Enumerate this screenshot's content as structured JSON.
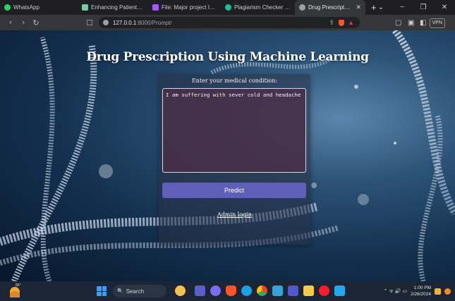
{
  "browser": {
    "tabs": [
      {
        "label": "WhatsApp",
        "icon": "whatsapp-icon",
        "color": "#25d366"
      },
      {
        "label": "Enhancing Patient Satisfactio",
        "icon": "doc-icon",
        "color": "#7bc8a4"
      },
      {
        "label": "File: Major project IEEE - Cop",
        "icon": "figma-icon",
        "color": "#a259ff"
      },
      {
        "label": "Plagiarism Checker | Grammar",
        "icon": "grammarly-icon",
        "color": "#15c39a"
      },
      {
        "label": "Drug Prescription Using",
        "icon": "globe-icon",
        "color": "#9aa0a6",
        "active": true
      }
    ],
    "new_tab": "+",
    "window_controls": {
      "list": "⌄",
      "minimize": "−",
      "maximize": "❐",
      "close": "✕"
    },
    "nav": {
      "back": "‹",
      "forward": "›",
      "reload": "↻",
      "bookmark": "☐"
    },
    "url": {
      "host": "127.0.0.1",
      "path": ":8000/Prompt/"
    },
    "vpn_label": "VPN",
    "share": "⇪",
    "brave": "▲",
    "extensions": [
      "▢",
      "▣",
      "◧"
    ]
  },
  "page": {
    "title": "Drug Prescription Using Machine Learning",
    "condition_label": "Enter your medical condition:",
    "condition_value": "I am suffering with sever cold and headache",
    "predict_label": "Predict",
    "admin_link": "Admin login"
  },
  "taskbar": {
    "weather_temp": "86°",
    "search_label": "Search",
    "search_icon": "🔍",
    "apps": [
      {
        "name": "file-explorer-icon",
        "color": "#f2c14e"
      },
      {
        "name": "chat-icon",
        "color": "#5b5fc7"
      },
      {
        "name": "brave-icon",
        "color": "#fb542b"
      },
      {
        "name": "edge-icon",
        "color": "#1ba1e2"
      },
      {
        "name": "chrome-icon",
        "color": "#fbbc05"
      },
      {
        "name": "store-icon",
        "color": "#36a3d9"
      },
      {
        "name": "teams-icon",
        "color": "#5059c9"
      },
      {
        "name": "folder-icon",
        "color": "#f7c948"
      },
      {
        "name": "opera-icon",
        "color": "#ff1b2d"
      },
      {
        "name": "vscode-icon",
        "color": "#22a7f0"
      }
    ],
    "tray_symbols": "⌃  ᯤ  🔊  ▭",
    "time": "1:00 PM",
    "date": "2/26/2024"
  }
}
